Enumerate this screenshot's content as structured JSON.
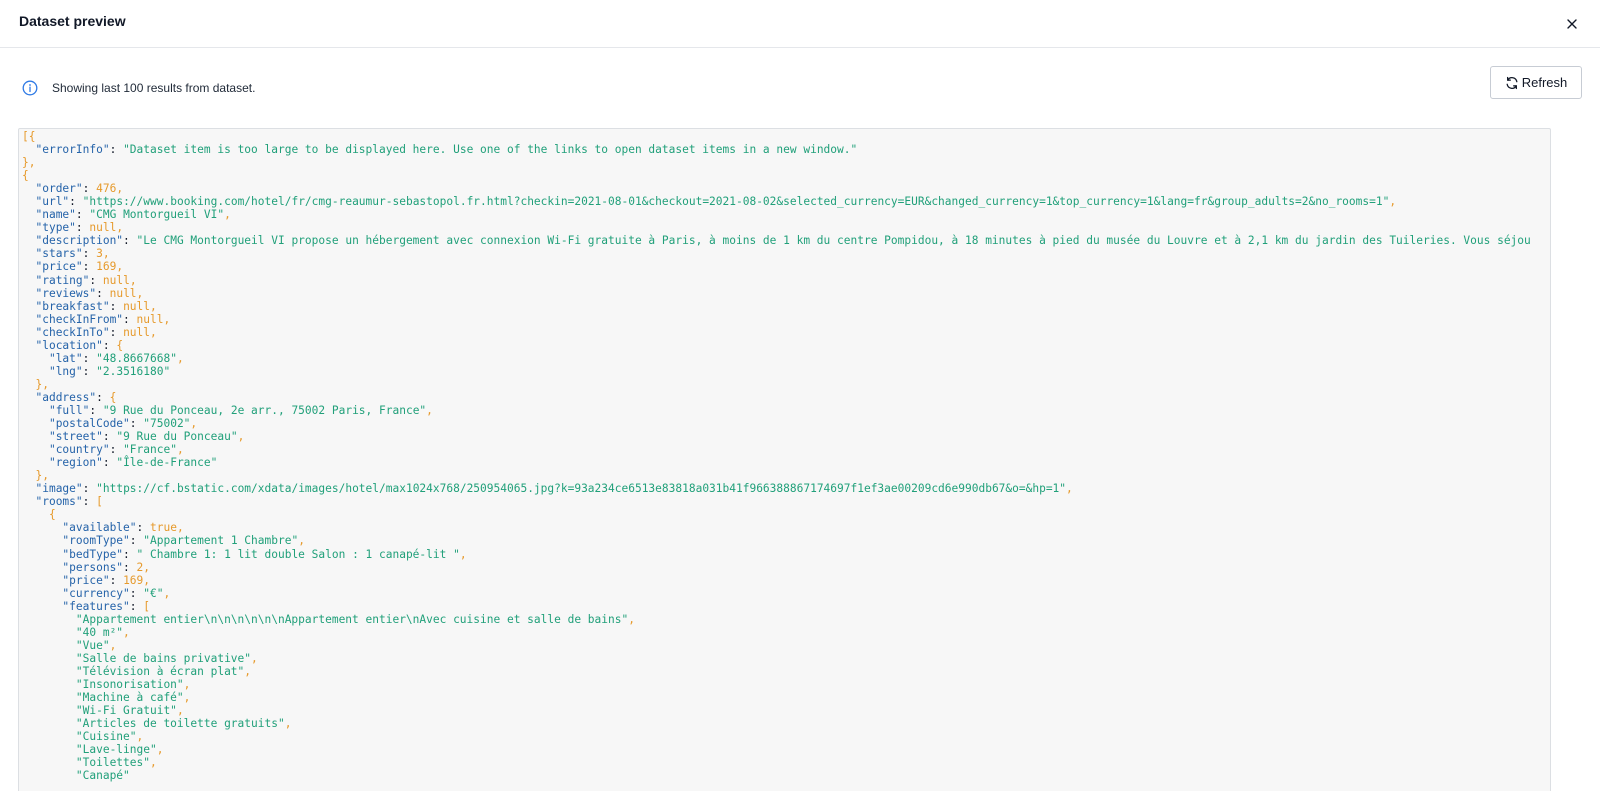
{
  "header": {
    "title": "Dataset preview",
    "close_label": "×"
  },
  "info": {
    "message": "Showing last 100 results from dataset."
  },
  "toolbar": {
    "refresh_label": "Refresh"
  },
  "colors": {
    "key": "#2563a9",
    "string": "#21a07a",
    "number_literal": "#e69a2c",
    "punctuation": "#e69a2c",
    "info_icon": "#2f7ae5"
  },
  "code_lines": [
    [
      [
        "p",
        "[{"
      ]
    ],
    [
      [
        "i",
        "  "
      ],
      [
        "k",
        "\"errorInfo\""
      ],
      [
        "t",
        ": "
      ],
      [
        "s",
        "\"Dataset item is too large to be displayed here. Use one of the links to open dataset items in a new window.\""
      ]
    ],
    [
      [
        "p",
        "},"
      ]
    ],
    [
      [
        "p",
        "{"
      ]
    ],
    [
      [
        "i",
        "  "
      ],
      [
        "k",
        "\"order\""
      ],
      [
        "t",
        ": "
      ],
      [
        "n",
        "476"
      ],
      [
        "p",
        ","
      ]
    ],
    [
      [
        "i",
        "  "
      ],
      [
        "k",
        "\"url\""
      ],
      [
        "t",
        ": "
      ],
      [
        "s",
        "\"https://www.booking.com/hotel/fr/cmg-reaumur-sebastopol.fr.html?checkin=2021-08-01&checkout=2021-08-02&selected_currency=EUR&changed_currency=1&top_currency=1&lang=fr&group_adults=2&no_rooms=1\""
      ],
      [
        "p",
        ","
      ]
    ],
    [
      [
        "i",
        "  "
      ],
      [
        "k",
        "\"name\""
      ],
      [
        "t",
        ": "
      ],
      [
        "s",
        "\"CMG Montorgueil VI\""
      ],
      [
        "p",
        ","
      ]
    ],
    [
      [
        "i",
        "  "
      ],
      [
        "k",
        "\"type\""
      ],
      [
        "t",
        ": "
      ],
      [
        "n",
        "null"
      ],
      [
        "p",
        ","
      ]
    ],
    [
      [
        "i",
        "  "
      ],
      [
        "k",
        "\"description\""
      ],
      [
        "t",
        ": "
      ],
      [
        "s",
        "\"Le CMG Montorgueil VI propose un hébergement avec connexion Wi-Fi gratuite à Paris, à moins de 1 km du centre Pompidou, à 18 minutes à pied du musée du Louvre et à 2,1 km du jardin des Tuileries. Vous séjou"
      ]
    ],
    [
      [
        "i",
        "  "
      ],
      [
        "k",
        "\"stars\""
      ],
      [
        "t",
        ": "
      ],
      [
        "n",
        "3"
      ],
      [
        "p",
        ","
      ]
    ],
    [
      [
        "i",
        "  "
      ],
      [
        "k",
        "\"price\""
      ],
      [
        "t",
        ": "
      ],
      [
        "n",
        "169"
      ],
      [
        "p",
        ","
      ]
    ],
    [
      [
        "i",
        "  "
      ],
      [
        "k",
        "\"rating\""
      ],
      [
        "t",
        ": "
      ],
      [
        "n",
        "null"
      ],
      [
        "p",
        ","
      ]
    ],
    [
      [
        "i",
        "  "
      ],
      [
        "k",
        "\"reviews\""
      ],
      [
        "t",
        ": "
      ],
      [
        "n",
        "null"
      ],
      [
        "p",
        ","
      ]
    ],
    [
      [
        "i",
        "  "
      ],
      [
        "k",
        "\"breakfast\""
      ],
      [
        "t",
        ": "
      ],
      [
        "n",
        "null"
      ],
      [
        "p",
        ","
      ]
    ],
    [
      [
        "i",
        "  "
      ],
      [
        "k",
        "\"checkInFrom\""
      ],
      [
        "t",
        ": "
      ],
      [
        "n",
        "null"
      ],
      [
        "p",
        ","
      ]
    ],
    [
      [
        "i",
        "  "
      ],
      [
        "k",
        "\"checkInTo\""
      ],
      [
        "t",
        ": "
      ],
      [
        "n",
        "null"
      ],
      [
        "p",
        ","
      ]
    ],
    [
      [
        "i",
        "  "
      ],
      [
        "k",
        "\"location\""
      ],
      [
        "t",
        ": "
      ],
      [
        "p",
        "{"
      ]
    ],
    [
      [
        "i",
        "    "
      ],
      [
        "k",
        "\"lat\""
      ],
      [
        "t",
        ": "
      ],
      [
        "s",
        "\"48.8667668\""
      ],
      [
        "p",
        ","
      ]
    ],
    [
      [
        "i",
        "    "
      ],
      [
        "k",
        "\"lng\""
      ],
      [
        "t",
        ": "
      ],
      [
        "s",
        "\"2.3516180\""
      ]
    ],
    [
      [
        "i",
        "  "
      ],
      [
        "p",
        "},"
      ]
    ],
    [
      [
        "i",
        "  "
      ],
      [
        "k",
        "\"address\""
      ],
      [
        "t",
        ": "
      ],
      [
        "p",
        "{"
      ]
    ],
    [
      [
        "i",
        "    "
      ],
      [
        "k",
        "\"full\""
      ],
      [
        "t",
        ": "
      ],
      [
        "s",
        "\"9 Rue du Ponceau, 2e arr., 75002 Paris, France\""
      ],
      [
        "p",
        ","
      ]
    ],
    [
      [
        "i",
        "    "
      ],
      [
        "k",
        "\"postalCode\""
      ],
      [
        "t",
        ": "
      ],
      [
        "s",
        "\"75002\""
      ],
      [
        "p",
        ","
      ]
    ],
    [
      [
        "i",
        "    "
      ],
      [
        "k",
        "\"street\""
      ],
      [
        "t",
        ": "
      ],
      [
        "s",
        "\"9 Rue du Ponceau\""
      ],
      [
        "p",
        ","
      ]
    ],
    [
      [
        "i",
        "    "
      ],
      [
        "k",
        "\"country\""
      ],
      [
        "t",
        ": "
      ],
      [
        "s",
        "\"France\""
      ],
      [
        "p",
        ","
      ]
    ],
    [
      [
        "i",
        "    "
      ],
      [
        "k",
        "\"region\""
      ],
      [
        "t",
        ": "
      ],
      [
        "s",
        "\"Île-de-France\""
      ]
    ],
    [
      [
        "i",
        "  "
      ],
      [
        "p",
        "},"
      ]
    ],
    [
      [
        "i",
        "  "
      ],
      [
        "k",
        "\"image\""
      ],
      [
        "t",
        ": "
      ],
      [
        "s",
        "\"https://cf.bstatic.com/xdata/images/hotel/max1024x768/250954065.jpg?k=93a234ce6513e83818a031b41f966388867174697f1ef3ae00209cd6e990db67&o=&hp=1\""
      ],
      [
        "p",
        ","
      ]
    ],
    [
      [
        "i",
        "  "
      ],
      [
        "k",
        "\"rooms\""
      ],
      [
        "t",
        ": "
      ],
      [
        "p",
        "["
      ]
    ],
    [
      [
        "i",
        "    "
      ],
      [
        "p",
        "{"
      ]
    ],
    [
      [
        "i",
        "      "
      ],
      [
        "k",
        "\"available\""
      ],
      [
        "t",
        ": "
      ],
      [
        "n",
        "true"
      ],
      [
        "p",
        ","
      ]
    ],
    [
      [
        "i",
        "      "
      ],
      [
        "k",
        "\"roomType\""
      ],
      [
        "t",
        ": "
      ],
      [
        "s",
        "\"Appartement 1 Chambre\""
      ],
      [
        "p",
        ","
      ]
    ],
    [
      [
        "i",
        "      "
      ],
      [
        "k",
        "\"bedType\""
      ],
      [
        "t",
        ": "
      ],
      [
        "s",
        "\" Chambre 1: 1 lit double Salon : 1 canapé-lit \""
      ],
      [
        "p",
        ","
      ]
    ],
    [
      [
        "i",
        "      "
      ],
      [
        "k",
        "\"persons\""
      ],
      [
        "t",
        ": "
      ],
      [
        "n",
        "2"
      ],
      [
        "p",
        ","
      ]
    ],
    [
      [
        "i",
        "      "
      ],
      [
        "k",
        "\"price\""
      ],
      [
        "t",
        ": "
      ],
      [
        "n",
        "169"
      ],
      [
        "p",
        ","
      ]
    ],
    [
      [
        "i",
        "      "
      ],
      [
        "k",
        "\"currency\""
      ],
      [
        "t",
        ": "
      ],
      [
        "s",
        "\"€\""
      ],
      [
        "p",
        ","
      ]
    ],
    [
      [
        "i",
        "      "
      ],
      [
        "k",
        "\"features\""
      ],
      [
        "t",
        ": "
      ],
      [
        "p",
        "["
      ]
    ],
    [
      [
        "i",
        "        "
      ],
      [
        "s",
        "\"Appartement entier\\n\\n\\n\\n\\n\\nAppartement entier\\nAvec cuisine et salle de bains\""
      ],
      [
        "p",
        ","
      ]
    ],
    [
      [
        "i",
        "        "
      ],
      [
        "s",
        "\"40 m²\""
      ],
      [
        "p",
        ","
      ]
    ],
    [
      [
        "i",
        "        "
      ],
      [
        "s",
        "\"Vue\""
      ],
      [
        "p",
        ","
      ]
    ],
    [
      [
        "i",
        "        "
      ],
      [
        "s",
        "\"Salle de bains privative\""
      ],
      [
        "p",
        ","
      ]
    ],
    [
      [
        "i",
        "        "
      ],
      [
        "s",
        "\"Télévision à écran plat\""
      ],
      [
        "p",
        ","
      ]
    ],
    [
      [
        "i",
        "        "
      ],
      [
        "s",
        "\"Insonorisation\""
      ],
      [
        "p",
        ","
      ]
    ],
    [
      [
        "i",
        "        "
      ],
      [
        "s",
        "\"Machine à café\""
      ],
      [
        "p",
        ","
      ]
    ],
    [
      [
        "i",
        "        "
      ],
      [
        "s",
        "\"Wi-Fi Gratuit\""
      ],
      [
        "p",
        ","
      ]
    ],
    [
      [
        "i",
        "        "
      ],
      [
        "s",
        "\"Articles de toilette gratuits\""
      ],
      [
        "p",
        ","
      ]
    ],
    [
      [
        "i",
        "        "
      ],
      [
        "s",
        "\"Cuisine\""
      ],
      [
        "p",
        ","
      ]
    ],
    [
      [
        "i",
        "        "
      ],
      [
        "s",
        "\"Lave-linge\""
      ],
      [
        "p",
        ","
      ]
    ],
    [
      [
        "i",
        "        "
      ],
      [
        "s",
        "\"Toilettes\""
      ],
      [
        "p",
        ","
      ]
    ],
    [
      [
        "i",
        "        "
      ],
      [
        "s",
        "\"Canapé\""
      ]
    ]
  ]
}
